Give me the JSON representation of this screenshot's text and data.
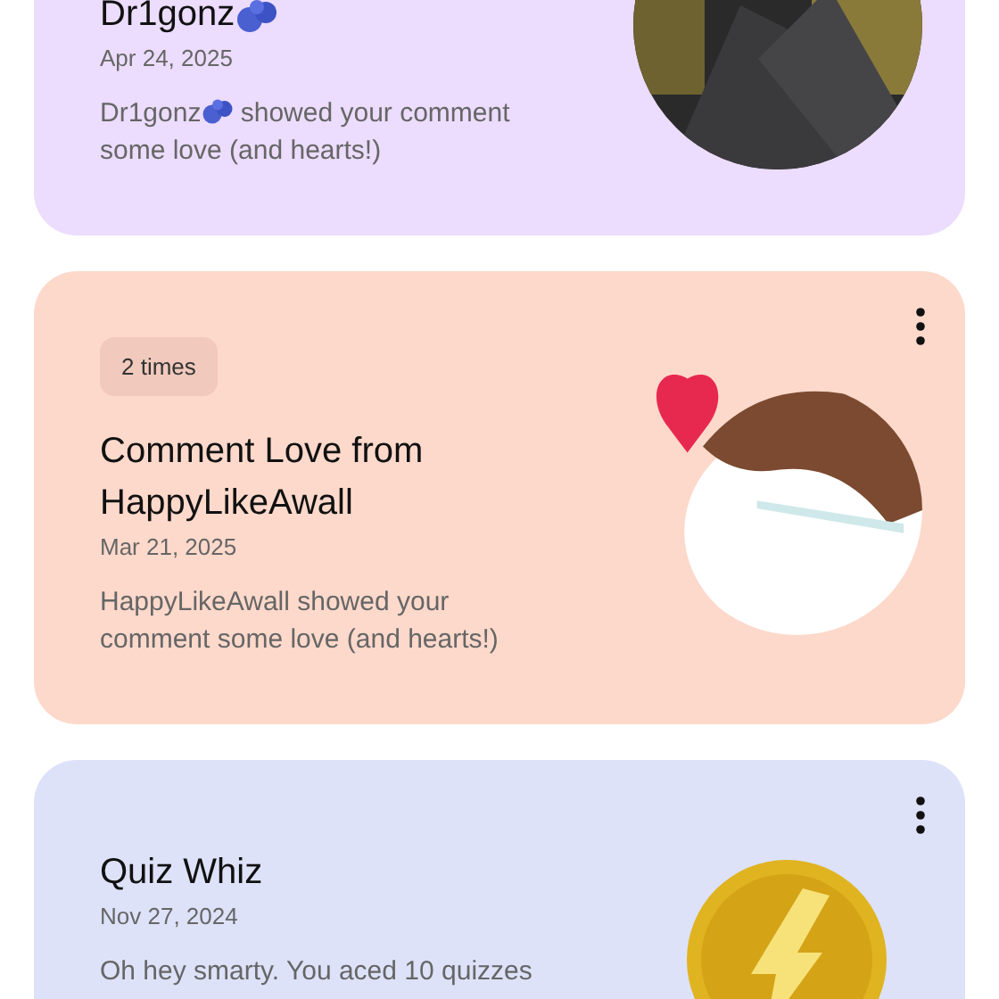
{
  "notifications": [
    {
      "kind": "comment_love",
      "color": "#ecdcfd",
      "menu_button": false,
      "emoji": true,
      "title": "Dr1gonz",
      "date": "Apr 24, 2025",
      "message_user": "Dr1gonz",
      "message": "showed your comment some love (and hearts!)"
    },
    {
      "kind": "comment_love",
      "color": "#fdd9cb",
      "menu_button": true,
      "emoji": false,
      "badge": "2 times",
      "title": "Comment Love from HappyLikeAwall",
      "date": "Mar 21, 2025",
      "message_user": "HappyLikeAwall",
      "message": "showed your comment some love (and hearts!)"
    },
    {
      "kind": "achievement",
      "color": "#dde2f9",
      "menu_button": true,
      "emoji": false,
      "title": "Quiz Whiz",
      "date": "Nov 27, 2024",
      "message": "Oh hey smarty. You aced 10 quizzes"
    }
  ]
}
